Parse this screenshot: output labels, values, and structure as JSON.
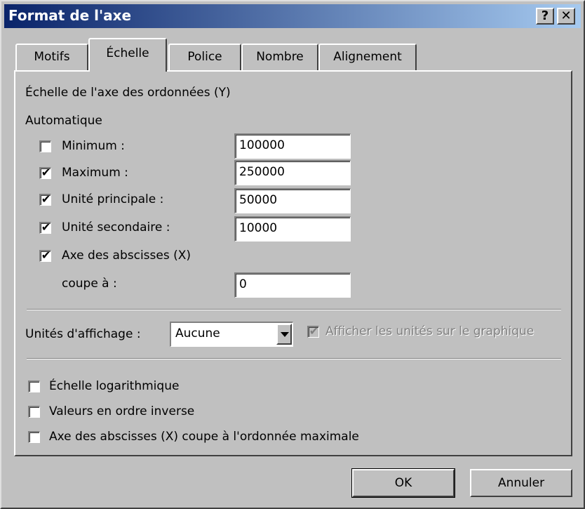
{
  "window": {
    "title": "Format de l'axe",
    "help_label": "?",
    "close_label": "✕"
  },
  "tabs": [
    {
      "label": "Motifs",
      "active": false
    },
    {
      "label": "Échelle",
      "active": true
    },
    {
      "label": "Police",
      "active": false
    },
    {
      "label": "Nombre",
      "active": false
    },
    {
      "label": "Alignement",
      "active": false
    }
  ],
  "scale": {
    "heading": "Échelle de l'axe des ordonnées (Y)",
    "auto_label": "Automatique",
    "rows": [
      {
        "label": "Minimum :",
        "checked": false,
        "value": "100000"
      },
      {
        "label": "Maximum :",
        "checked": true,
        "value": "250000"
      },
      {
        "label": "Unité principale :",
        "checked": true,
        "value": "50000"
      },
      {
        "label": "Unité secondaire :",
        "checked": true,
        "value": "10000"
      },
      {
        "label": "Axe des abscisses (X)",
        "checked": true
      }
    ],
    "crosses_label": "coupe à :",
    "crosses_value": "0"
  },
  "display_units": {
    "label": "Unités d'affichage :",
    "value": "Aucune",
    "show_label": "Afficher les unités sur le graphique",
    "show_checked": true,
    "show_disabled": true
  },
  "options": [
    {
      "label": "Échelle logarithmique",
      "checked": false
    },
    {
      "label": "Valeurs en ordre inverse",
      "checked": false
    },
    {
      "label": "Axe des abscisses (X) coupe à l'ordonnée maximale",
      "checked": false
    }
  ],
  "buttons": {
    "ok": "OK",
    "cancel": "Annuler"
  },
  "icons": {
    "check": "checkmark-icon",
    "dropdown": "chevron-down-icon",
    "help": "help-icon",
    "close": "close-icon"
  },
  "colors": {
    "titlebar_start": "#0a246a",
    "titlebar_end": "#a6caf0",
    "face": "#c0c0c0"
  }
}
